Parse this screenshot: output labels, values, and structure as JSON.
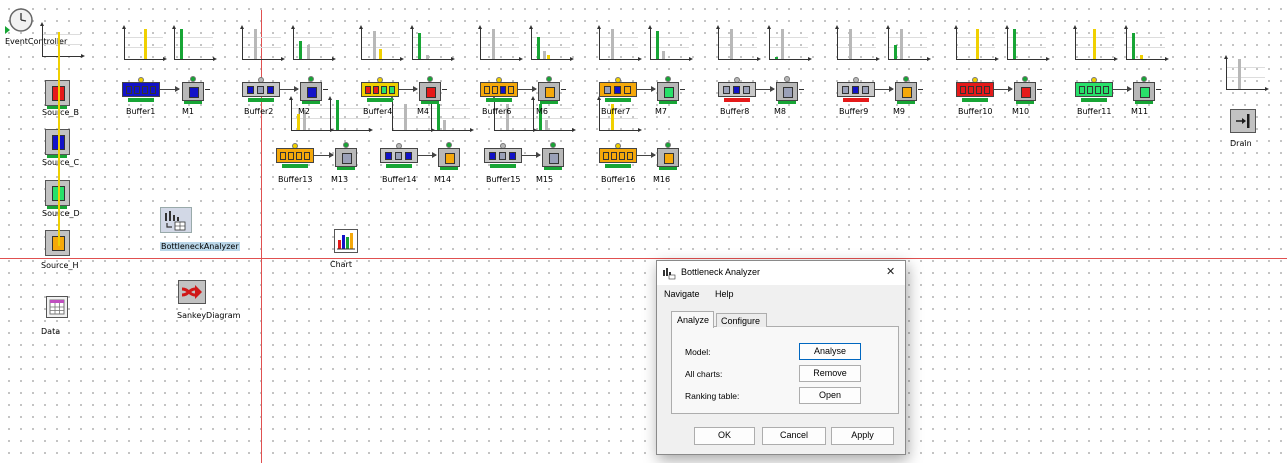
{
  "canvas": {
    "event_controller": "EventController",
    "sources": [
      "Source_B",
      "Source_C",
      "Source_D",
      "Source_H"
    ],
    "row1_buffers": [
      "Buffer1",
      "Buffer2",
      "Buffer4",
      "Buffer6",
      "Buffer7",
      "Buffer8",
      "Buffer9",
      "Buffer10",
      "Buffer11"
    ],
    "row1_machines": [
      "M1",
      "M2",
      "M4",
      "M6",
      "M7",
      "M8",
      "M9",
      "M10",
      "M11"
    ],
    "row2_buffers": [
      "Buffer13",
      "Buffer14",
      "Buffer15",
      "Buffer16"
    ],
    "row2_machines": [
      "M13",
      "M14",
      "M15",
      "M16"
    ],
    "drain": "Drain",
    "bottleneck_analyzer": "BottleneckAnalyzer",
    "chart": "Chart",
    "data": "Data",
    "sankey": "SankeyDiagram"
  },
  "colors": {
    "green": "#17a535",
    "yellow": "#f0d000",
    "red": "#e51a1a",
    "blue": "#1212c8",
    "orange": "#f5a80a",
    "light_green": "#28e06a",
    "gray": "#9aa0b8",
    "grid_line": "#e05050"
  },
  "dialog": {
    "title": "Bottleneck Analyzer",
    "menu": [
      "Navigate",
      "Help"
    ],
    "tabs": [
      "Analyze",
      "Configure"
    ],
    "active_tab": "Analyze",
    "rows": [
      {
        "label": "Model:",
        "button": "Analyse"
      },
      {
        "label": "All charts:",
        "button": "Remove"
      },
      {
        "label": "Ranking table:",
        "button": "Open"
      }
    ],
    "footer": [
      "OK",
      "Cancel",
      "Apply"
    ],
    "close_glyph": "✕"
  }
}
